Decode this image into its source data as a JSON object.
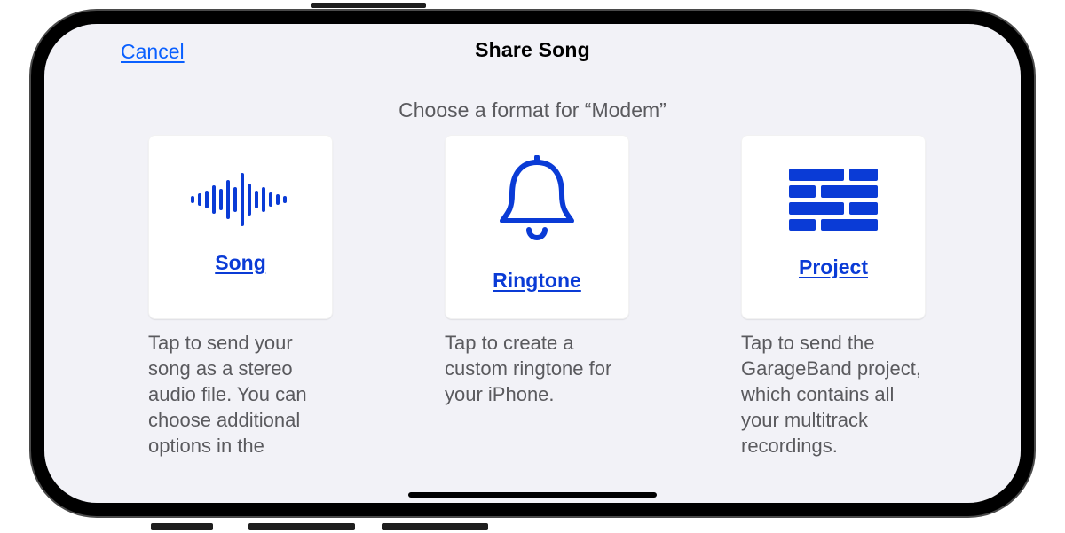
{
  "nav": {
    "cancel_label": "Cancel",
    "title": "Share Song"
  },
  "subtitle": "Choose a format for “Modem”",
  "options": [
    {
      "icon": "waveform-icon",
      "label": "Song",
      "description": "Tap to send your song as a stereo audio file. You can choose additional options in the"
    },
    {
      "icon": "bell-icon",
      "label": "Ringtone",
      "description": "Tap to create a custom ringtone for your iPhone."
    },
    {
      "icon": "bricks-icon",
      "label": "Project",
      "description": "Tap to send the GarageBand project, which contains all your multitrack recordings."
    }
  ],
  "colors": {
    "blue_link": "#0a60ff",
    "blue_strong": "#0a3bd6",
    "panel_bg": "#f2f2f7",
    "card_bg": "#ffffff",
    "text_secondary": "#5a5a5e"
  }
}
